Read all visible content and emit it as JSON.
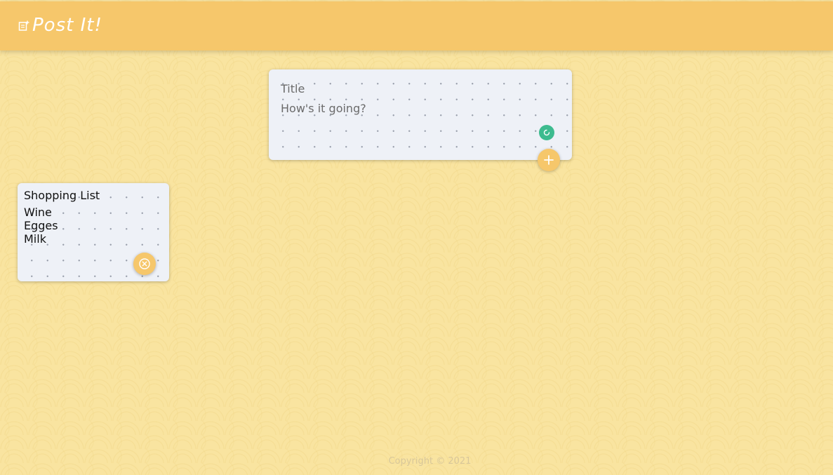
{
  "header": {
    "app_title": "Post It!",
    "logo_icon": "note-add-icon"
  },
  "create_area": {
    "title_placeholder": "Title",
    "content_placeholder": "How's it going?",
    "status_icon": "loading-spinner-icon",
    "add_icon": "plus-icon"
  },
  "notes": [
    {
      "title": "Shopping List",
      "lines": [
        "Wine",
        "Egges",
        "Milk"
      ],
      "delete_icon": "close-circle-icon"
    }
  ],
  "footer": {
    "copyright": "Copyright © 2021"
  },
  "colors": {
    "header_bg": "#f6c76b",
    "page_bg": "#f9e4a0",
    "note_bg": "#eef1f7",
    "accent_green": "#3dbb8f"
  }
}
